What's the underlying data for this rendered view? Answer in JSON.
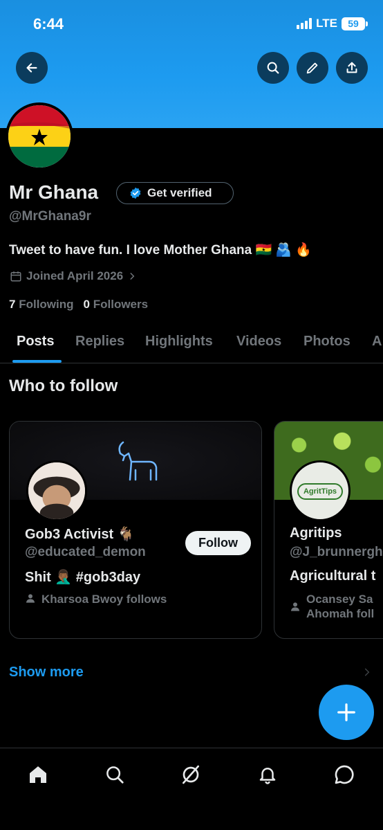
{
  "status_bar": {
    "time": "6:44",
    "network": "LTE",
    "battery": "59"
  },
  "colors": {
    "accent": "#1d9bf0",
    "banner": "#1d9bf0",
    "background": "#000000",
    "muted": "#71767b",
    "text": "#e7e9ea"
  },
  "header": {
    "back_icon": "arrow-left-icon",
    "search_icon": "search-icon",
    "edit_icon": "pencil-icon",
    "share_icon": "share-icon"
  },
  "profile": {
    "name": "Mr Ghana",
    "get_verified_label": "Get verified",
    "handle": "@MrGhana9r",
    "bio": "Tweet to have fun. I love Mother Ghana 🇬🇭 🫂 🔥",
    "joined": "Joined April 2026",
    "following_count": "7",
    "following_label": "Following",
    "followers_count": "0",
    "followers_label": "Followers"
  },
  "tabs": [
    {
      "label": "Posts",
      "active": true
    },
    {
      "label": "Replies"
    },
    {
      "label": "Highlights"
    },
    {
      "label": "Videos"
    },
    {
      "label": "Photos"
    },
    {
      "label": "A"
    }
  ],
  "who_to_follow": {
    "title": "Who to follow",
    "cards": [
      {
        "name": "Gob3 Activist 🐐",
        "handle": "@educated_demon",
        "bio": "Shit 🤦🏾‍♂️ #gob3day",
        "social_context": "Kharsoa Bwoy follows",
        "follow_label": "Follow"
      },
      {
        "name": "Agritips",
        "handle": "@J_brunnergh",
        "bio": "Agricultural t",
        "social_context_line1": "Ocansey Sa",
        "social_context_line2": "Ahomah foll",
        "logo_text": "AgritTips"
      }
    ],
    "show_more_label": "Show more"
  },
  "fab": {
    "icon": "plus-icon"
  },
  "bottom_nav": [
    "home-icon",
    "search-icon",
    "grok-icon",
    "bell-icon",
    "messages-icon"
  ]
}
